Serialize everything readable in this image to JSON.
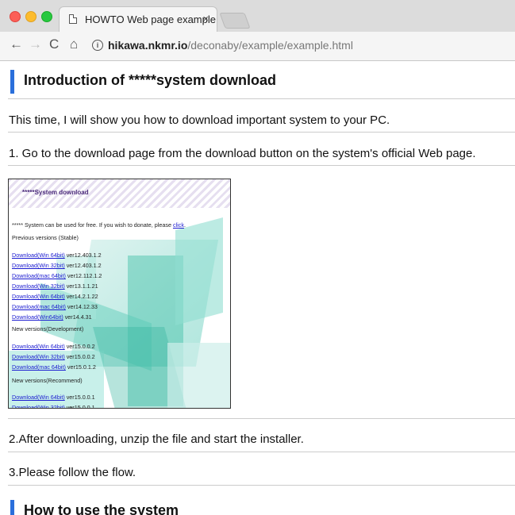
{
  "browser": {
    "tab_title": "HOWTO Web page example",
    "tab_close": "×",
    "url_host": "hikawa.nkmr.io",
    "url_path": "/deconaby/example/example.html",
    "icons": {
      "back": "←",
      "forward": "→",
      "reload": "C",
      "home": "⌂",
      "info": "i"
    }
  },
  "page": {
    "heading1": "Introduction of *****system download",
    "intro": "This time, I will show you how to download important system to your PC.",
    "step1": "1. Go to the download page from the download button on the system's official Web page.",
    "step2": "2.After downloading, unzip the file and start the installer.",
    "step3": "3.Please follow the flow.",
    "heading2": "How to use the system",
    "accent_color": "#2a6fdb"
  },
  "screenshot": {
    "title": "*****System download",
    "free_text": "***** System can be used for free. If you wish to donate, please",
    "click_link": "click",
    "click_suffix": ".",
    "prev_label": "Previous versions (Stable)",
    "prev_items": [
      {
        "link": "Download(Win 64bit)",
        "ver": "ver12.403.1.2"
      },
      {
        "link": "Download(Win 32bit)",
        "ver": "ver12.403.1.2"
      },
      {
        "link": "Download(mac 64bit)",
        "ver": "ver12.112.1.2"
      },
      {
        "link": "Download(Win 32bit)",
        "ver": "ver13.1.1.21"
      },
      {
        "link": "Download(Win 64bit)",
        "ver": "ver14.2.1.22"
      },
      {
        "link": "Download(mac 64bit)",
        "ver": "ver14.12.33"
      },
      {
        "link": "Download(Win64bit)",
        "ver": "ver14.4.31"
      }
    ],
    "dev_label": "New versions(Development)",
    "dev_items": [
      {
        "link": "Download(Win 64bit)",
        "ver": "ver15.0.0.2"
      },
      {
        "link": "Download(Win 32bit)",
        "ver": "ver15.0.0.2"
      },
      {
        "link": "Download(mac 64bit)",
        "ver": "ver15.0.1.2"
      }
    ],
    "rec_label": "New versions(Recommend)",
    "rec_items": [
      {
        "link": "Download(Win 64bit)",
        "ver": "ver15.0.0.1"
      },
      {
        "link": "Download(Win 32bit)",
        "ver": "ver15.0.0.1"
      }
    ]
  }
}
